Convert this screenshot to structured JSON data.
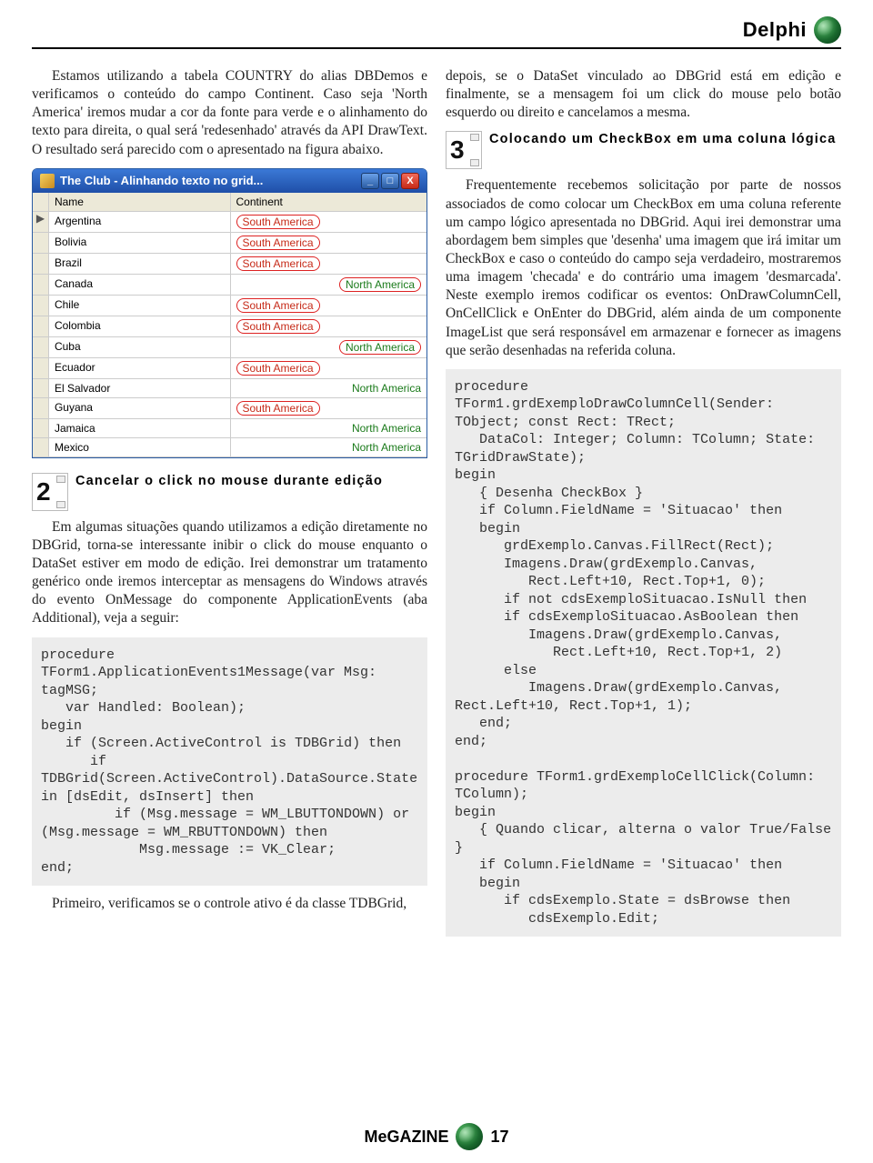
{
  "header": {
    "title": "Delphi"
  },
  "left": {
    "para1": "Estamos utilizando a tabela COUNTRY do alias DBDemos e verificamos o conteúdo do campo Continent. Caso seja 'North America' iremos mudar a cor da fonte para verde e o alinhamento do texto para direita, o qual será 'redesenhado' através da API DrawText. O resultado será parecido com o apresentado na figura abaixo.",
    "window": {
      "title": "The Club - Alinhando texto no grid...",
      "columns": {
        "name": "Name",
        "continent": "Continent"
      },
      "rows": [
        {
          "name": "Argentina",
          "continent": "South America",
          "oval": true,
          "right": false,
          "marker": "▶"
        },
        {
          "name": "Bolivia",
          "continent": "South America",
          "oval": true,
          "right": false,
          "marker": ""
        },
        {
          "name": "Brazil",
          "continent": "South America",
          "oval": true,
          "right": false,
          "marker": ""
        },
        {
          "name": "Canada",
          "continent": "North America",
          "oval": true,
          "right": true,
          "marker": ""
        },
        {
          "name": "Chile",
          "continent": "South America",
          "oval": true,
          "right": false,
          "marker": ""
        },
        {
          "name": "Colombia",
          "continent": "South America",
          "oval": true,
          "right": false,
          "marker": ""
        },
        {
          "name": "Cuba",
          "continent": "North America",
          "oval": true,
          "right": true,
          "marker": ""
        },
        {
          "name": "Ecuador",
          "continent": "South America",
          "oval": true,
          "right": false,
          "marker": ""
        },
        {
          "name": "El Salvador",
          "continent": "North America",
          "oval": false,
          "right": true,
          "marker": ""
        },
        {
          "name": "Guyana",
          "continent": "South America",
          "oval": true,
          "right": false,
          "marker": ""
        },
        {
          "name": "Jamaica",
          "continent": "North America",
          "oval": false,
          "right": true,
          "marker": ""
        },
        {
          "name": "Mexico",
          "continent": "North America",
          "oval": false,
          "right": true,
          "marker": ""
        }
      ],
      "buttons": {
        "min": "_",
        "max": "□",
        "close": "X"
      }
    },
    "step2": {
      "num": "2",
      "title": "Cancelar o click no mouse durante edição"
    },
    "para2": "Em algumas situações quando utilizamos a edição diretamente no DBGrid, torna-se interessante inibir o click do mouse enquanto o DataSet estiver em modo de edição. Irei demonstrar um tratamento genérico onde iremos interceptar as mensagens do Windows através do evento OnMessage do componente ApplicationEvents (aba Additional), veja a seguir:",
    "code1": "procedure\nTForm1.ApplicationEvents1Message(var Msg:\ntagMSG;\n   var Handled: Boolean);\nbegin\n   if (Screen.ActiveControl is TDBGrid) then\n      if\nTDBGrid(Screen.ActiveControl).DataSource.State\nin [dsEdit, dsInsert] then\n         if (Msg.message = WM_LBUTTONDOWN) or\n(Msg.message = WM_RBUTTONDOWN) then\n            Msg.message := VK_Clear;\nend;",
    "para3": "Primeiro, verificamos se o controle ativo é da classe TDBGrid,"
  },
  "right": {
    "para1": "depois, se o DataSet vinculado ao DBGrid está em edição e finalmente, se a mensagem foi um click do mouse pelo botão esquerdo ou direito e cancelamos a mesma.",
    "step3": {
      "num": "3",
      "title": "Colocando um CheckBox em uma coluna lógica"
    },
    "para2": "Frequentemente recebemos solicitação por parte de nossos associados de como colocar um CheckBox em uma coluna referente um campo lógico apresentada no DBGrid. Aqui irei demonstrar uma abordagem bem simples que 'desenha' uma imagem que irá imitar um CheckBox e caso o conteúdo do campo seja verdadeiro, mostraremos uma imagem 'checada' e do contrário uma imagem 'desmarcada'. Neste exemplo iremos codificar os eventos: OnDrawColumnCell, OnCellClick e OnEnter do DBGrid, além ainda de um componente ImageList que será responsável em armazenar e fornecer as imagens que serão desenhadas na referida coluna.",
    "code1": "procedure\nTForm1.grdExemploDrawColumnCell(Sender:\nTObject; const Rect: TRect;\n   DataCol: Integer; Column: TColumn; State:\nTGridDrawState);\nbegin\n   { Desenha CheckBox }\n   if Column.FieldName = 'Situacao' then\n   begin\n      grdExemplo.Canvas.FillRect(Rect);\n      Imagens.Draw(grdExemplo.Canvas,\n         Rect.Left+10, Rect.Top+1, 0);\n      if not cdsExemploSituacao.IsNull then\n      if cdsExemploSituacao.AsBoolean then\n         Imagens.Draw(grdExemplo.Canvas,\n            Rect.Left+10, Rect.Top+1, 2)\n      else\n         Imagens.Draw(grdExemplo.Canvas,\nRect.Left+10, Rect.Top+1, 1);\n   end;\nend;\n\nprocedure TForm1.grdExemploCellClick(Column:\nTColumn);\nbegin\n   { Quando clicar, alterna o valor True/False\n}\n   if Column.FieldName = 'Situacao' then\n   begin\n      if cdsExemplo.State = dsBrowse then\n         cdsExemplo.Edit;"
  },
  "footer": {
    "mag": "MeGAZINE",
    "page": "17"
  }
}
